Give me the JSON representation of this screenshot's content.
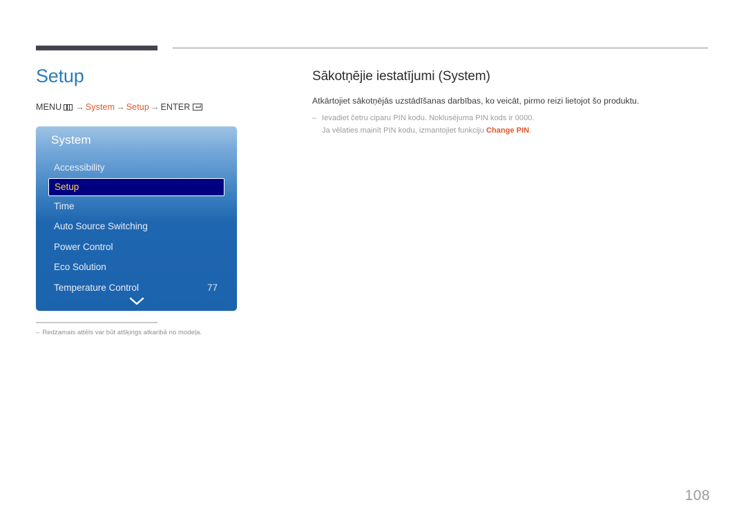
{
  "document": {
    "page_number": "108"
  },
  "left": {
    "title": "Setup",
    "breadcrumb": {
      "menu_label": "MENU",
      "menu_icon": "menu-grid-icon",
      "arrow": "→",
      "step_system": "System",
      "step_setup": "Setup",
      "enter_label": "ENTER",
      "enter_icon": "enter-return-icon"
    },
    "note_dash": "–",
    "note": "Redzamais attēls var būt atšķirigs atkaribā no modeļa."
  },
  "osd": {
    "header": "System",
    "chevron_icon": "chevron-down-icon",
    "items": [
      {
        "label": "Accessibility",
        "value": "",
        "selected": false
      },
      {
        "label": "Setup",
        "value": "",
        "selected": true
      },
      {
        "label": "Time",
        "value": "",
        "selected": false
      },
      {
        "label": "Auto Source Switching",
        "value": "",
        "selected": false
      },
      {
        "label": "Power Control",
        "value": "",
        "selected": false
      },
      {
        "label": "Eco Solution",
        "value": "",
        "selected": false
      },
      {
        "label": "Temperature Control",
        "value": "77",
        "selected": false
      }
    ]
  },
  "right": {
    "title": "Sākotņējie iestatījumi (System)",
    "description": "Atkārtojiet sākotņējās uzstādīšanas darbības, ko veicāt, pirmo reizi lietojot šo produktu.",
    "note_dash": "–",
    "note_line1": "Ievadiet četru ciparu PIN kodu. Noklusējuma PIN kods ir 0000.",
    "note_line2_before": "Ja vēlaties mainīt PIN kodu, izmantojiet funkciju ",
    "note_line2_accent": "Change PIN",
    "note_line2_after": "."
  },
  "colors": {
    "title_blue": "#2b7cb9",
    "accent_orange": "#e1562c",
    "osd_blue": "#1c63ad",
    "osd_selected_bg": "#000080",
    "osd_selected_text": "#ffd24a",
    "rule_dark": "#474250",
    "page_number_gray": "#9a9aa0"
  }
}
